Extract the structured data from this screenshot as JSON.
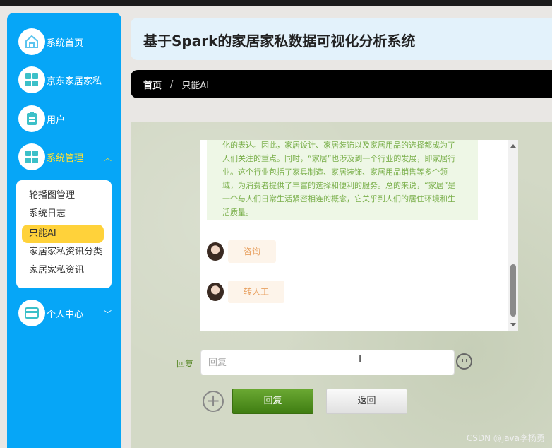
{
  "sidebar": {
    "items": [
      {
        "label": "系统首页",
        "icon": "home-icon"
      },
      {
        "label": "京东家居家私",
        "icon": "grid-icon"
      },
      {
        "label": "用户",
        "icon": "clipboard-icon"
      },
      {
        "label": "系统管理",
        "icon": "grid-icon"
      },
      {
        "label": "个人中心",
        "icon": "card-icon"
      }
    ],
    "submenu": [
      "轮播图管理",
      "系统日志",
      "只能AI",
      "家居家私资讯分类",
      "家居家私资讯"
    ]
  },
  "header": {
    "title": "基于Spark的家居家私数据可视化分析系统"
  },
  "breadcrumb": {
    "home": "首页",
    "separator": "/",
    "current": "只能AI"
  },
  "chat": {
    "ai_text": "化的表达。因此，家居设计、家居装饰以及家居用品的选择都成为了人们关注的重点。同时，“家居”也涉及到一个行业的发展，即家居行业。这个行业包括了家具制造、家居装饰、家居用品销售等多个领域，为消费者提供了丰富的选择和便利的服务。总的来说，“家居”是一个与人们日常生活紧密相连的概念，它关乎到人们的居住环境和生活质量。",
    "messages": [
      "咨询",
      "转人工"
    ]
  },
  "reply": {
    "label": "回复",
    "placeholder": "回复",
    "submit": "回复",
    "back": "返回"
  },
  "watermark": "CSDN @java李杨勇",
  "colors": {
    "sidebar": "#06a6f7",
    "active": "#ffd23a",
    "reply_button": "#4f8f1e"
  }
}
